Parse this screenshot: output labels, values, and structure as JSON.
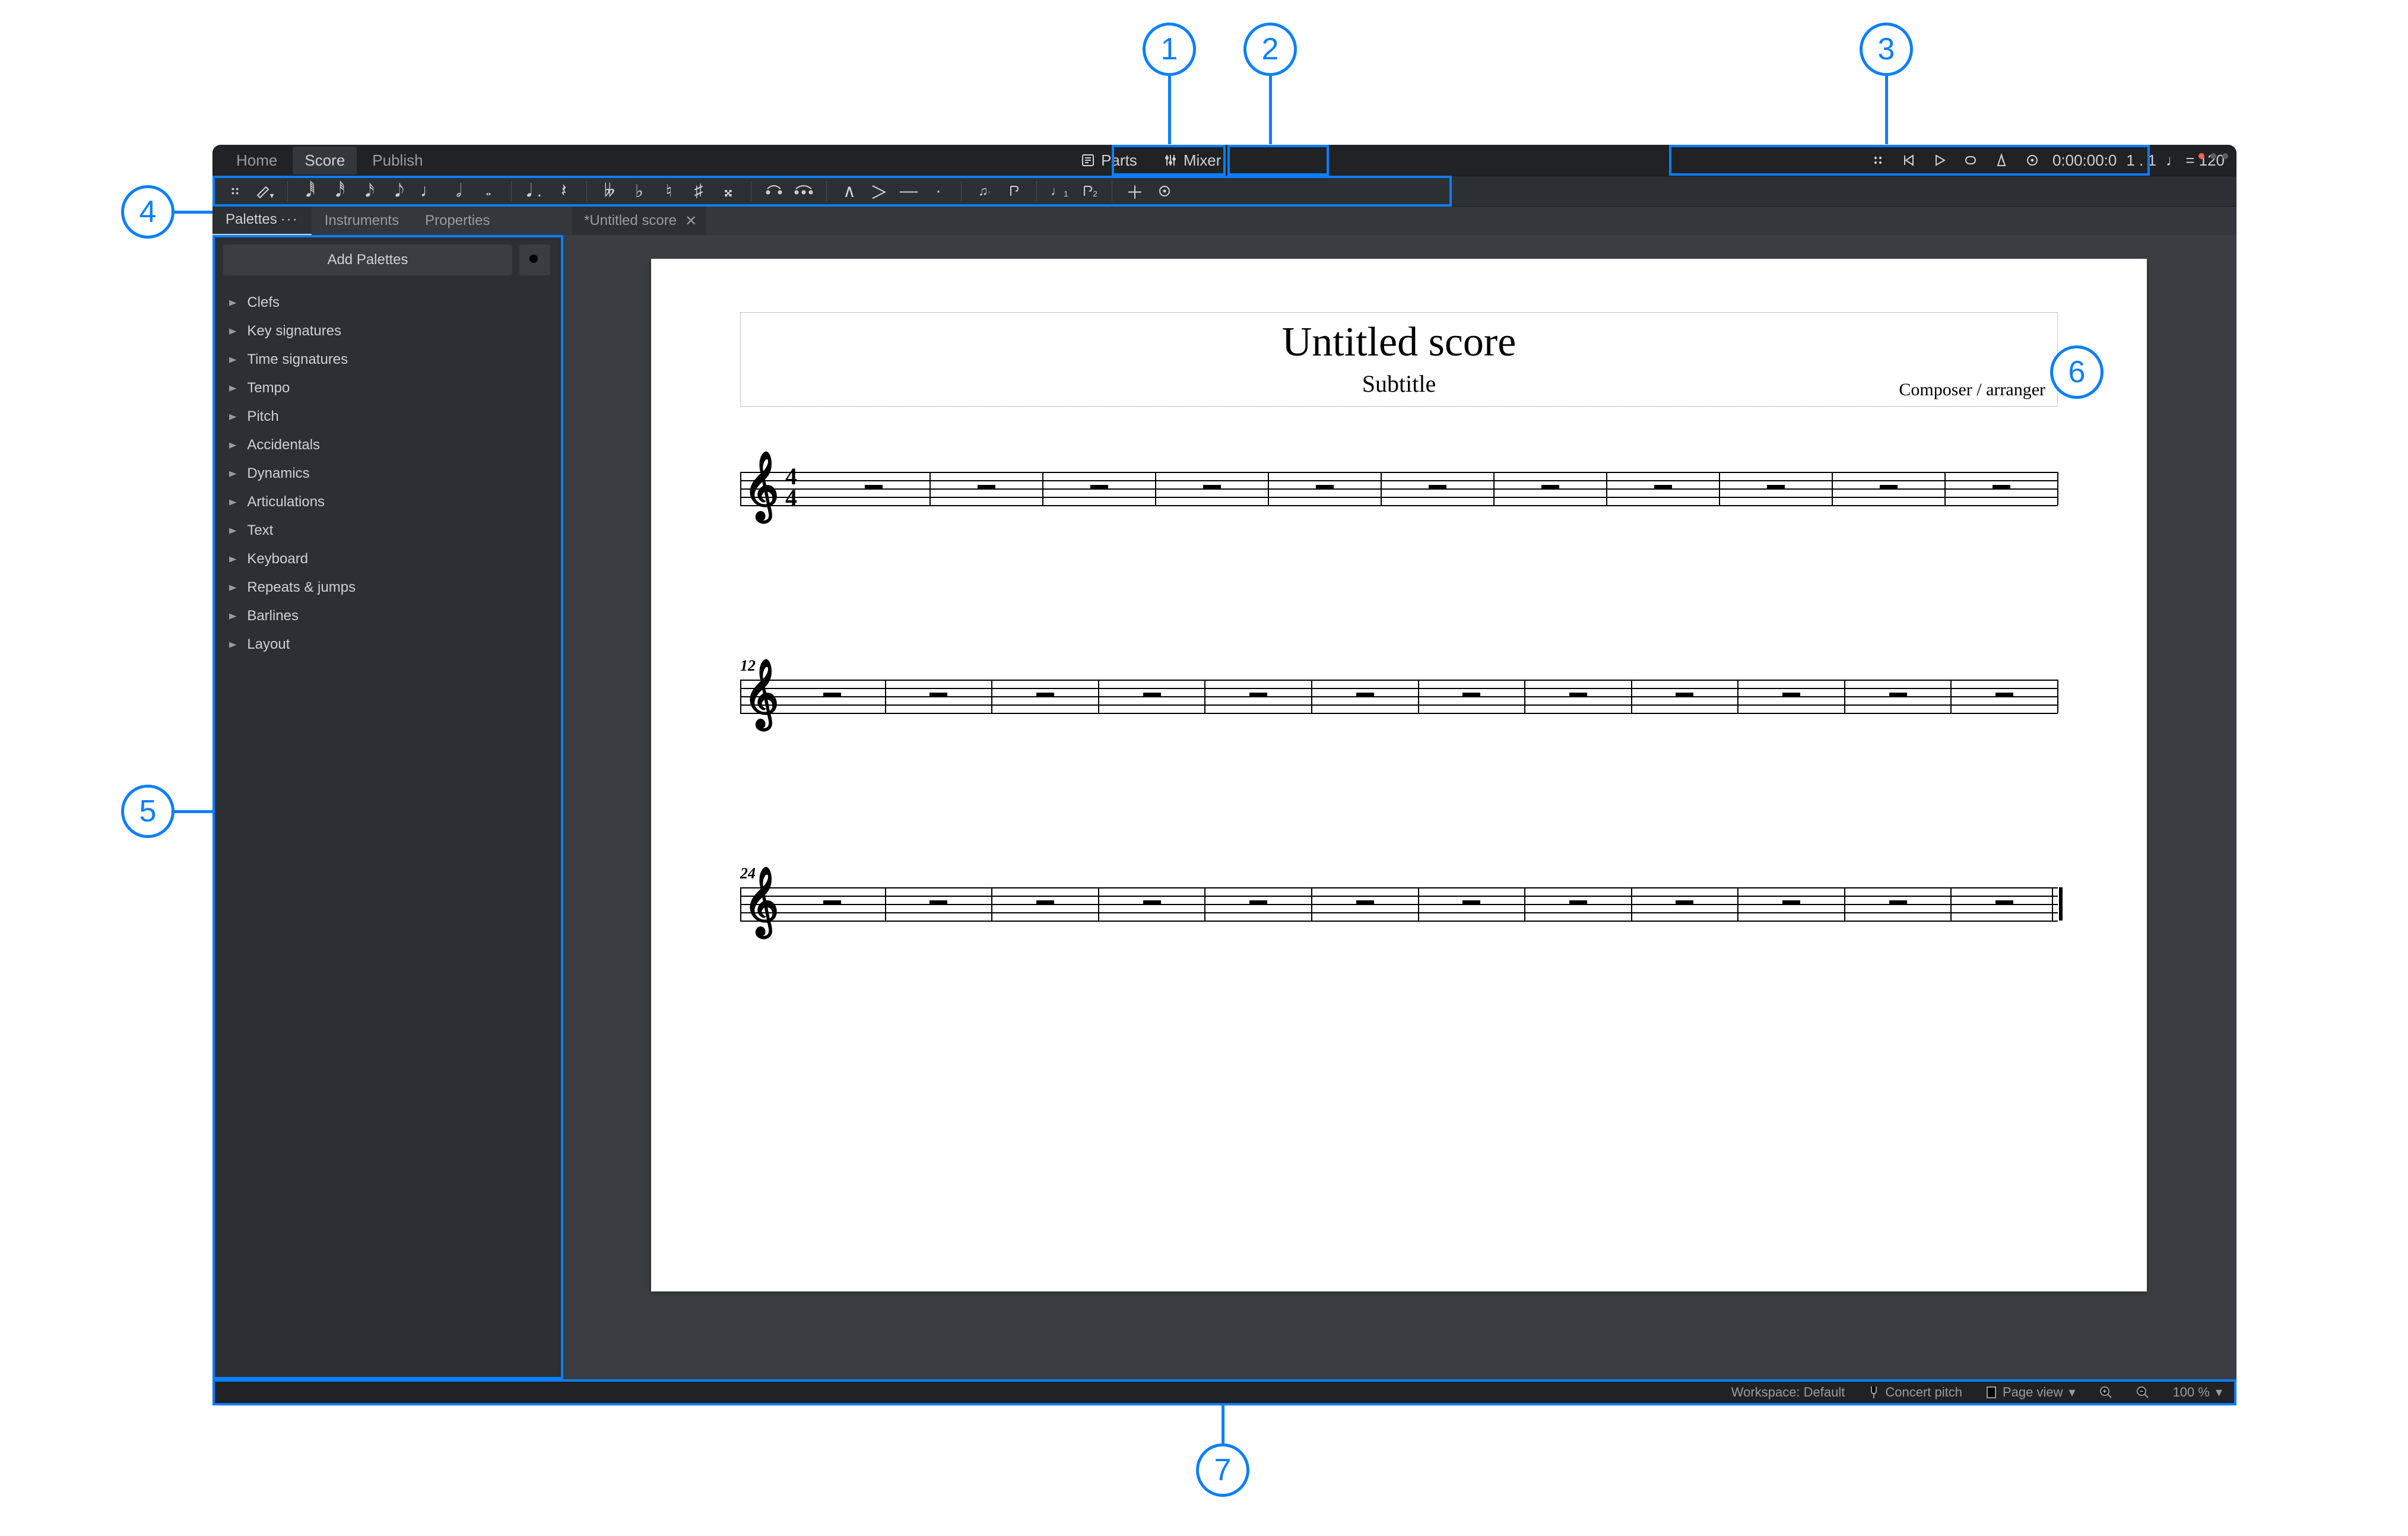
{
  "callouts": {
    "c1": "1",
    "c2": "2",
    "c3": "3",
    "c4": "4",
    "c5": "5",
    "c6": "6",
    "c7": "7"
  },
  "menubar": {
    "tabs": {
      "home": "Home",
      "score": "Score",
      "publish": "Publish"
    },
    "parts": "Parts",
    "mixer": "Mixer",
    "playback": {
      "time": "0:00:00:0",
      "beat": "1 . 1",
      "tempo_note": "♩",
      "tempo_eq": "=",
      "tempo_value": "120"
    }
  },
  "panel_tabs": {
    "palettes": "Palettes",
    "instruments": "Instruments",
    "properties": "Properties"
  },
  "doc_tab": "*Untitled score",
  "sidebar": {
    "add": "Add Palettes",
    "items": [
      "Clefs",
      "Key signatures",
      "Time signatures",
      "Tempo",
      "Pitch",
      "Accidentals",
      "Dynamics",
      "Articulations",
      "Text",
      "Keyboard",
      "Repeats & jumps",
      "Barlines",
      "Layout"
    ]
  },
  "score": {
    "title": "Untitled score",
    "subtitle": "Subtitle",
    "composer": "Composer / arranger",
    "systems": [
      {
        "measure_label": "",
        "measures": 11,
        "show_ts": true,
        "first": true
      },
      {
        "measure_label": "12",
        "measures": 12,
        "show_ts": false,
        "first": false
      },
      {
        "measure_label": "24",
        "measures": 12,
        "show_ts": false,
        "first": false,
        "final": true
      }
    ]
  },
  "status": {
    "workspace": "Workspace: Default",
    "concert": "Concert pitch",
    "view": "Page view",
    "zoom": "100 %"
  }
}
